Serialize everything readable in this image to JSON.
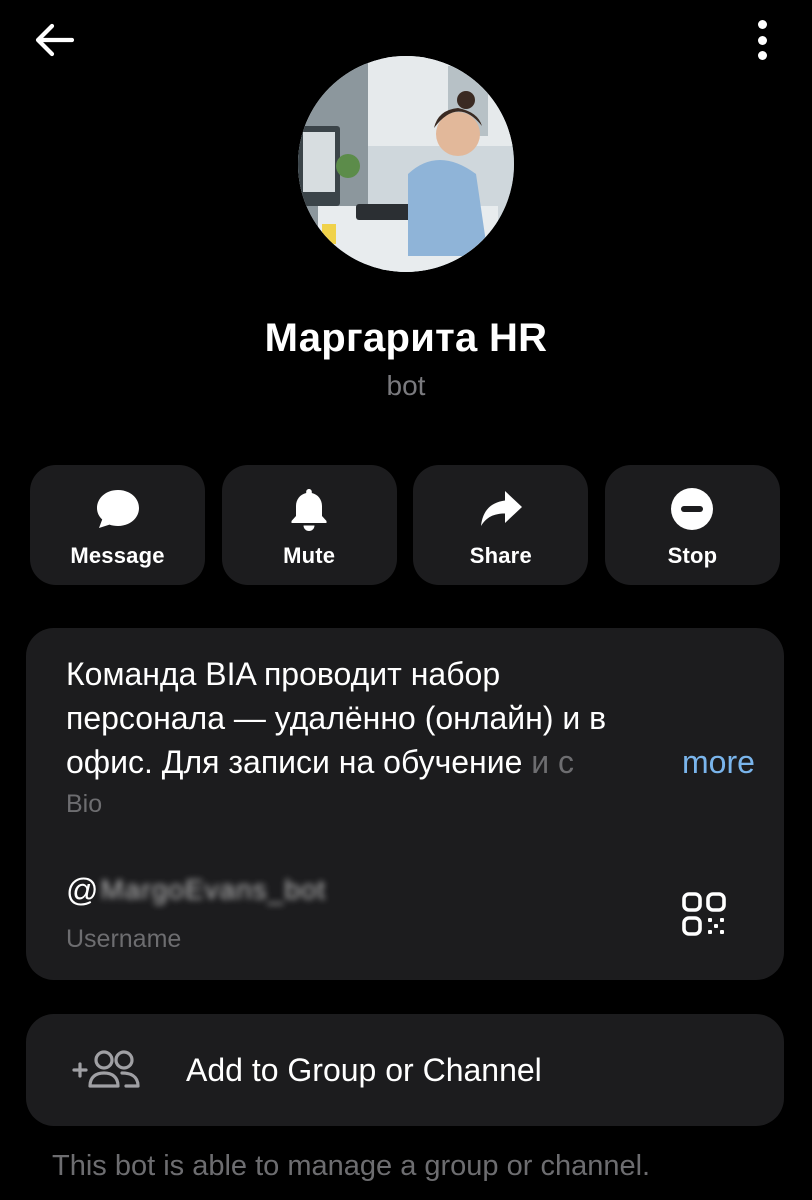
{
  "header": {
    "back_icon": "arrow-left-icon",
    "menu_icon": "more-vertical-icon"
  },
  "profile": {
    "name": "Маргарита HR",
    "subtitle": "bot"
  },
  "actions": [
    {
      "label": "Message",
      "icon": "chat-bubble-icon"
    },
    {
      "label": "Mute",
      "icon": "bell-icon"
    },
    {
      "label": "Share",
      "icon": "share-arrow-icon"
    },
    {
      "label": "Stop",
      "icon": "stop-icon"
    }
  ],
  "bio": {
    "line1": "Команда BIA проводит набор",
    "line2": "персонала — удалённо (онлайн) и в",
    "line3": "офис. Для записи на обучение",
    "line3_fade": " и с",
    "more_label": "more",
    "label": "Bio"
  },
  "username": {
    "at_sign": "@",
    "value_obscured": "MargoEvans_bot",
    "label": "Username",
    "qr_icon": "qr-code-icon"
  },
  "add_to_group": {
    "label": "Add to Group or Channel",
    "icon": "add-users-icon"
  },
  "footer": {
    "note": "This bot is able to manage a group or channel."
  },
  "colors": {
    "background": "#000000",
    "card": "#1c1c1e",
    "secondary_text": "#6d6d70",
    "link": "#7ab5ec"
  }
}
